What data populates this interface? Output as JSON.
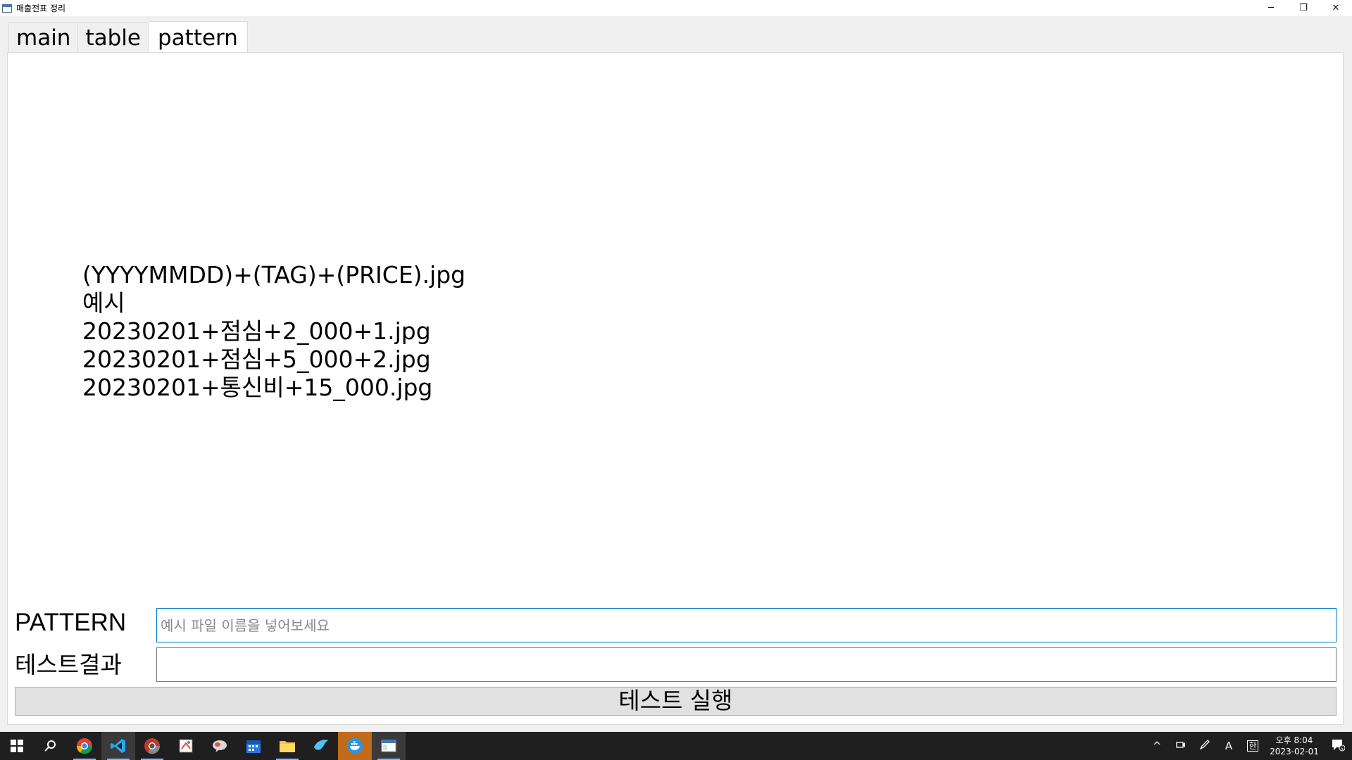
{
  "window": {
    "title": "매출전표 정리",
    "minimize": "─",
    "restore": "❐",
    "close": "✕"
  },
  "tabs": [
    {
      "label": "main"
    },
    {
      "label": "table"
    },
    {
      "label": "pattern",
      "active": true
    }
  ],
  "pattern_info": {
    "lines": [
      "(YYYYMMDD)+(TAG)+(PRICE).jpg",
      "예시",
      "20230201+점심+2_000+1.jpg",
      "20230201+점심+5_000+2.jpg",
      "20230201+통신비+15_000.jpg"
    ]
  },
  "form": {
    "pattern_label": "PATTERN",
    "pattern_placeholder": "예시 파일 이름을 넣어보세요",
    "pattern_value": "",
    "result_label": "테스트결과",
    "result_value": "",
    "run_button": "테스트 실행"
  },
  "taskbar": {
    "apps": [
      "windows-start-icon",
      "search-icon",
      "chrome-icon",
      "vscode-icon",
      "chrome-dev-icon",
      "paint-icon",
      "chat-icon",
      "calendar-icon",
      "file-explorer-icon",
      "bird-app-icon",
      "docker-icon",
      "python-app-icon"
    ],
    "tray_chevron": "^",
    "ime_mode": "A",
    "ime_hangul": "한",
    "clock_ampm_time": "오후 8:04",
    "clock_date": "2023-02-01",
    "notification_count": "5"
  },
  "colors": {
    "accent": "#0078d7",
    "taskbar_bg": "#1f1f1f",
    "highlight_app": "#c06a1a"
  }
}
